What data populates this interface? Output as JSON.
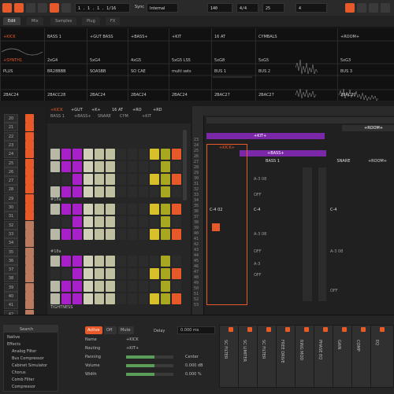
{
  "transport": {
    "position": "1 . 1 . 1 . 1/16",
    "tempo": "140",
    "time_sig": "4/4",
    "mode": "Sync",
    "sync_value": "Internal",
    "zoom": "25",
    "latency": "4"
  },
  "tabs": [
    "Edit",
    "Mix",
    "Samples",
    "Plug",
    "FX"
  ],
  "overview": {
    "tracks": [
      {
        "name": "+KICK",
        "clip": "+SYNTH1",
        "info": "PLUS"
      },
      {
        "name": "BASS 1",
        "clip": "2xG4",
        "info": "BR28BBB"
      },
      {
        "name": "+GUT BASS",
        "clip": "5xG4",
        "info": "SOASBB"
      },
      {
        "name": "+BASS+",
        "clip": "4xG5",
        "info": "SO CAE"
      },
      {
        "name": "+KIT",
        "clip": "5xG5 LS5",
        "info": "multi sets"
      },
      {
        "name": "16  AT",
        "clip": "5xG8",
        "info": "BUS 1"
      },
      {
        "name": "CYMBALS",
        "clip": "5xG5",
        "info": "BUS 2"
      },
      {
        "name": "+ROOM+",
        "clip": "5xG3",
        "info": "BUS 3"
      }
    ],
    "bottom_vals": [
      "2BAC24",
      "2BACC28",
      "2BAC24",
      "2BAC24",
      "2BAC24",
      "2BAC27",
      "2BAC27",
      "2BAC27"
    ]
  },
  "row_numbers": [
    "20",
    "21",
    "22",
    "23",
    "24",
    "25",
    "26",
    "27",
    "28",
    "29",
    "30",
    "31",
    "32",
    "33",
    "34",
    "35",
    "36",
    "37",
    "38",
    "39",
    "40",
    "41",
    "42",
    "43",
    "44",
    "45",
    "46"
  ],
  "grid": {
    "headers": [
      "+KICK",
      "+GUT",
      "+K+",
      "16 AT",
      "+RO",
      "+RD"
    ],
    "subheaders": [
      "BASS 1",
      "+BASS+",
      "SNARE",
      "CYM",
      "+KIT"
    ],
    "section_labels": [
      "#18a",
      "#18a",
      "#18a"
    ],
    "footer": "TIGHTNESS"
  },
  "editor": {
    "tracks": [
      {
        "name": "+KICK+",
        "color": "#e8592a"
      },
      {
        "name": "BASS 1",
        "color": "#b04dd9"
      },
      {
        "name": "SNARE",
        "color": "#b6b6b6"
      },
      {
        "name": "+ROOM+",
        "color": "#b04dd9"
      }
    ],
    "banners": [
      "+KIT+",
      "+BASS+",
      "+ROOM+"
    ],
    "line_numbers": [
      "23",
      "24",
      "25",
      "26",
      "27",
      "28",
      "29",
      "30",
      "31",
      "32",
      "33",
      "34",
      "35",
      "36",
      "37",
      "38",
      "39",
      "40",
      "41",
      "42",
      "43",
      "44",
      "45",
      "46",
      "47",
      "48",
      "49",
      "50",
      "51",
      "52",
      "53"
    ],
    "notes": [
      "C-4",
      "A-3 08",
      "OFF",
      "C-4 02",
      "A-3 08",
      "OFF",
      "A-3",
      "OFF",
      "A-3 08",
      "OFF"
    ]
  },
  "bottom": {
    "browser": {
      "title": "Search",
      "items": [
        "Native",
        "Effects",
        "Analog Filter",
        "Bus Compressor",
        "Cabinet Simulator",
        "Chorus",
        "Comb Filter",
        "Compressor"
      ]
    },
    "mode_buttons": [
      "Active",
      "Off",
      "Mute"
    ],
    "delay_label": "Delay",
    "delay_value": "0.000 ms",
    "params": [
      {
        "label": "Name",
        "value": "+KICK"
      },
      {
        "label": "Routing",
        "value": "+KIT+"
      },
      {
        "label": "Panning",
        "value": "Center"
      },
      {
        "label": "Volume",
        "value": "0.000 dB"
      },
      {
        "label": "Width",
        "value": "0.000 %"
      }
    ],
    "devices": [
      "SC FILTER",
      "SC LIMITER",
      "SC FILTER",
      "FREE DRIVE",
      "RING MOD",
      "PHASE EQ",
      "GAIN",
      "COMP",
      "EQ"
    ]
  }
}
